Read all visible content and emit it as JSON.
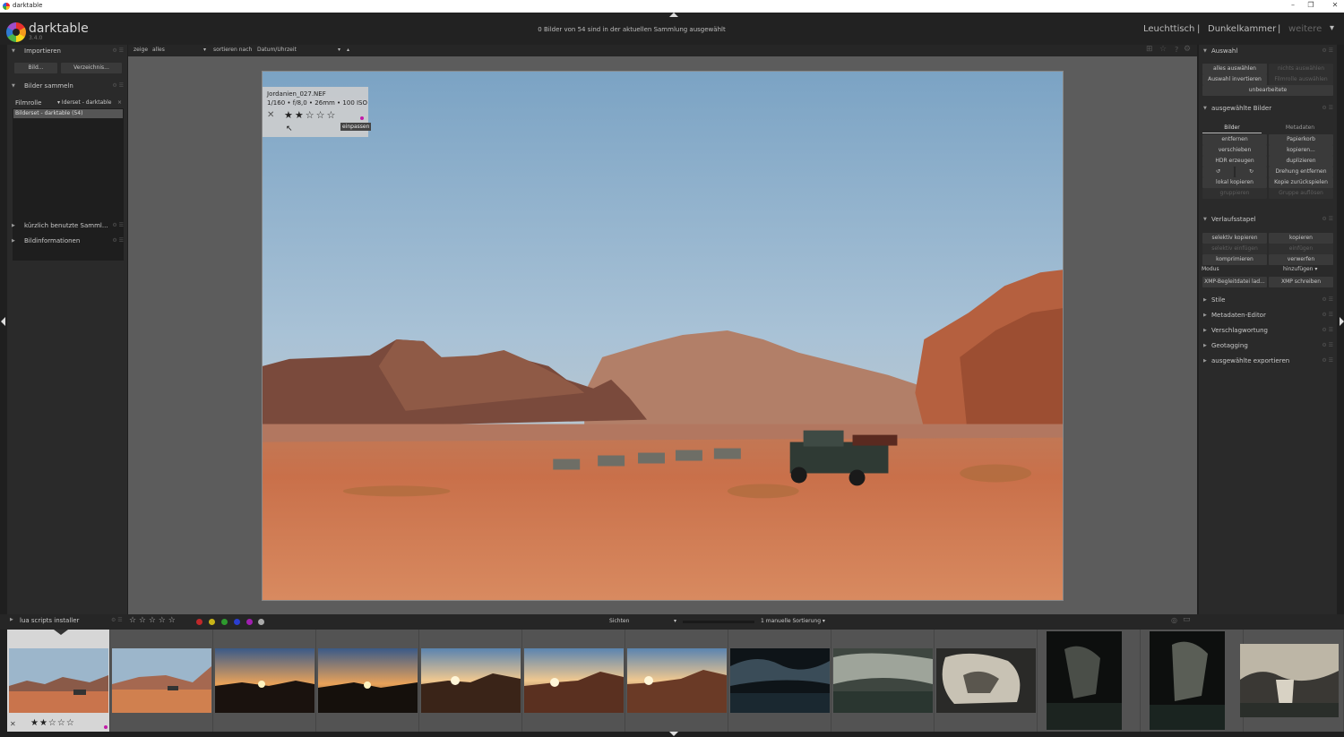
{
  "window": {
    "title": "darktable",
    "minimize": "–",
    "restore": "❐",
    "close": "✕"
  },
  "header": {
    "logo_text": "darktable",
    "version": "3.4.0",
    "message": "0 Bilder von 54 sind in der aktuellen Sammlung ausgewählt",
    "views": [
      {
        "label": "Leuchttisch"
      },
      {
        "label": "|"
      },
      {
        "label": "Dunkelkammer"
      },
      {
        "label": "|"
      },
      {
        "label": "weitere"
      }
    ],
    "views_dropdown": "▾"
  },
  "left_panel": {
    "import": {
      "title": "Importieren",
      "btn_image": "Bild...",
      "btn_folder": "Verzeichnis..."
    },
    "collect": {
      "title": "Bilder sammeln",
      "filmroll_label": "Filmrolle",
      "filmroll_value": "▾ Iderset - darktable",
      "filmroll_remove": "×",
      "selected_item": "Bilderset - darktable (54)"
    },
    "recent": {
      "title": "kürzlich benutzte Samml..."
    },
    "image_info": {
      "title": "Bildinformationen"
    },
    "lua": {
      "title": "lua scripts installer"
    }
  },
  "toolbar": {
    "show_label": "zeige",
    "show_value": "alles",
    "sort_label": "sortieren nach",
    "sort_value": "Datum/Uhrzeit",
    "sort_dir": "▴"
  },
  "overlay": {
    "filename": "Jordanien_027.NEF",
    "exif": "1/160 • f/8,0 • 26mm • 100 ISO",
    "reject": "✕",
    "stars": "★★☆☆☆",
    "rating": 2,
    "tooltip": "einpassen"
  },
  "right_panel": {
    "select": {
      "title": "Auswahl",
      "buttons": [
        "alles auswählen",
        "nichts auswählen",
        "Auswahl invertieren",
        "Filmrolle auswählen",
        "unbearbeitete"
      ]
    },
    "selected_images": {
      "title": "ausgewählte Bilder",
      "tabs": [
        "Bilder",
        "Metadaten"
      ],
      "buttons": [
        "entfernen",
        "Papierkorb",
        "verschieben",
        "kopieren...",
        "HDR erzeugen",
        "duplizieren",
        "↺",
        "↻",
        "Drehung entfernen",
        "lokal kopieren",
        "Kopie zurückspielen",
        "gruppieren",
        "Gruppe auflösen"
      ]
    },
    "history": {
      "title": "Verlaufsstapel",
      "buttons": [
        "selektiv kopieren",
        "kopieren",
        "selektiv einfügen",
        "einfügen",
        "komprimieren",
        "verwerfen",
        "XMP-Begleitdatei lad...",
        "XMP schreiben"
      ],
      "mode_label": "Modus",
      "mode_value": "hinzufügen ▾"
    },
    "collapsed": [
      "Stile",
      "Metadaten-Editor",
      "Verschlagwortung",
      "Geotagging",
      "ausgewählte exportieren"
    ]
  },
  "bottombar": {
    "stars": "☆ ☆ ☆ ☆ ☆",
    "colors": [
      "#c0282a",
      "#c8b418",
      "#2e9a2e",
      "#2a3ed0",
      "#a11fb0",
      "#aaaaaa"
    ],
    "view_label": "Sichten",
    "view_arrow": "▾",
    "sort_label": "1 manuelle Sortierung ▾"
  },
  "filmstrip": {
    "first_stars": "★★☆☆☆",
    "first_reject": "✕",
    "thumbnails": [
      "desert-jeep",
      "desert-jeep-far",
      "sunset-1",
      "sunset-2",
      "sunset-3",
      "sunset-4",
      "sunset-5",
      "cave-dark",
      "cave-blue",
      "cave-rocks",
      "cave-portrait-1",
      "cave-portrait-2",
      "cave-portrait-3"
    ]
  }
}
